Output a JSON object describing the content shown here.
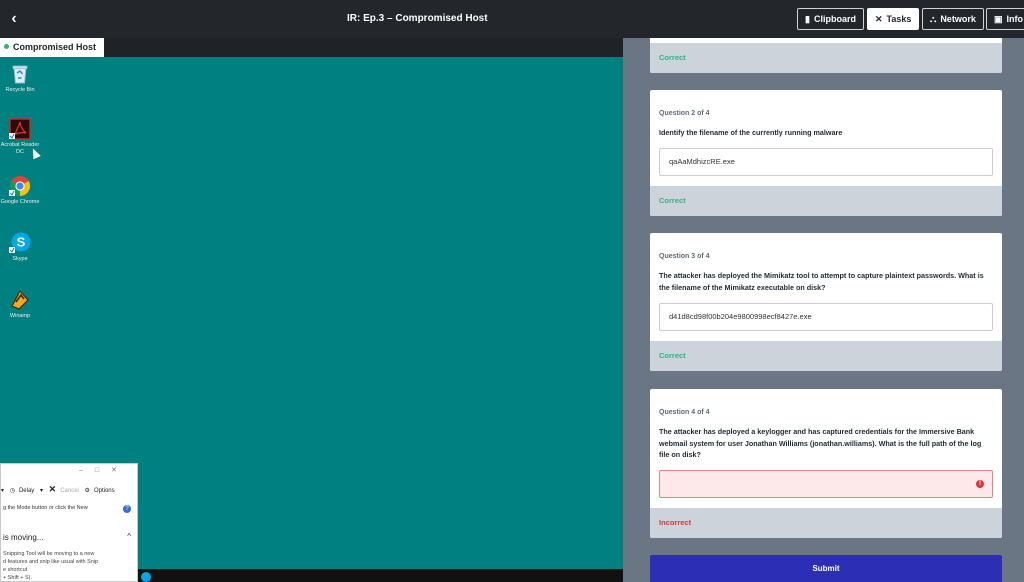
{
  "header": {
    "back_glyph": "‹",
    "title": "IR: Ep.3 – Compromised Host",
    "buttons": [
      {
        "label": "Clipboard",
        "glyph": "▮",
        "icon": "clipboard-icon",
        "active": false
      },
      {
        "label": "Tasks",
        "glyph": "✕",
        "icon": "close-icon",
        "active": true
      },
      {
        "label": "Network",
        "glyph": "⛬",
        "icon": "network-icon",
        "active": false
      },
      {
        "label": "Info",
        "glyph": "▣",
        "icon": "info-icon",
        "active": false
      }
    ]
  },
  "desktop": {
    "tab_label": "Compromised Host",
    "icons": [
      {
        "label": "Recycle Bin",
        "icon": "recycle-bin-icon"
      },
      {
        "label": "Acrobat Reader DC",
        "icon": "acrobat-reader-icon"
      },
      {
        "label": "Google Chrome",
        "icon": "chrome-icon"
      },
      {
        "label": "Skype",
        "icon": "skype-icon"
      },
      {
        "label": "Winamp",
        "icon": "winamp-icon"
      }
    ],
    "snipping": {
      "delay_label": "Delay",
      "cancel_label": "Cancel",
      "options_label": "Options",
      "hint": "g the Mode button or click the New",
      "moving_title": "is moving...",
      "body_lines": [
        "Snipping Tool will be moving to a new",
        "d features and snip like usual with Snip",
        "e shortcut",
        "+ Shift + S)."
      ]
    }
  },
  "questions": {
    "q1": {
      "result": "Correct"
    },
    "q2": {
      "number": "Question 2 of 4",
      "text": "Identify the filename of the currently running malware",
      "answer": "qaAaMdhizcRE.exe",
      "result": "Correct"
    },
    "q3": {
      "number": "Question 3 of 4",
      "text": "The attacker has deployed the Mimikatz tool to attempt to capture plaintext passwords. What is the filename of the Mimikatz executable on disk?",
      "answer": "d41d8cd98f00b204e9800998ecf8427e.exe",
      "result": "Correct"
    },
    "q4": {
      "number": "Question 4 of 4",
      "text": "The attacker has deployed a keylogger and has captured credentials for the Immersive Bank webmail system for user Jonathan Williams (jonathan.williams). What is the full path of the log file on disk?",
      "answer": "",
      "error_glyph": "!",
      "result": "Incorrect"
    }
  },
  "submit_label": "Submit",
  "colors": {
    "correct": "#2fb386",
    "incorrect": "#d9363e",
    "submit": "#2c2fb5",
    "desktop": "#008080"
  }
}
